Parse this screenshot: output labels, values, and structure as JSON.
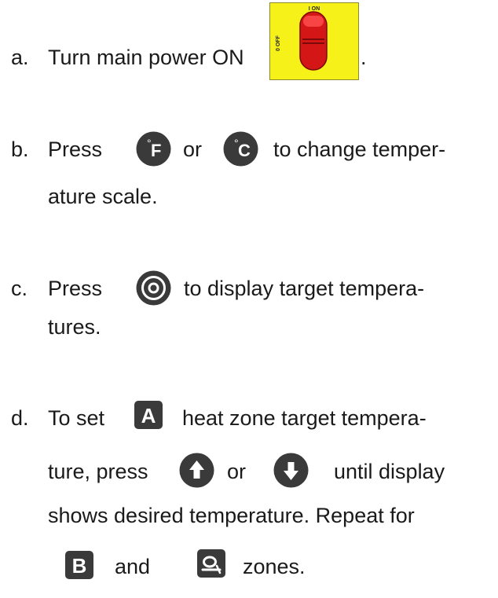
{
  "steps": {
    "a": {
      "marker": "a.",
      "text": "Turn main power ON",
      "suffix": ".",
      "switch": {
        "on_label": "I ON",
        "off_label": "0 OFF",
        "icon": "power-switch-icon"
      }
    },
    "b": {
      "marker": "b.",
      "press": "Press",
      "or": "or",
      "rest": "to change temper-",
      "line2": "ature scale.",
      "button_f": {
        "label": "F",
        "degree": "°",
        "icon": "fahrenheit-button-icon"
      },
      "button_c": {
        "label": "C",
        "degree": "°",
        "icon": "celsius-button-icon"
      }
    },
    "c": {
      "marker": "c.",
      "press": "Press",
      "rest": "to display target tempera-",
      "line2": "tures.",
      "button": {
        "icon": "target-button-icon"
      }
    },
    "d": {
      "marker": "d.",
      "to_set": "To set",
      "rest1": "heat zone target tempera-",
      "ture_press": "ture, press",
      "or": "or",
      "until": "until display",
      "line3": "shows desired temperature. Repeat for",
      "and": "and",
      "zones": "zones.",
      "zone_a": {
        "label": "A",
        "icon": "zone-a-button-icon"
      },
      "zone_b": {
        "label": "B",
        "icon": "zone-b-button-icon"
      },
      "zone_q": {
        "icon": "zone-q-button-icon"
      },
      "up": {
        "icon": "up-arrow-button-icon"
      },
      "down": {
        "icon": "down-arrow-button-icon"
      }
    }
  },
  "colors": {
    "text": "#1a1a1a",
    "button_dark": "#3a3a3a",
    "switch_bg": "#f7f11a",
    "switch_red": "#d41616"
  }
}
